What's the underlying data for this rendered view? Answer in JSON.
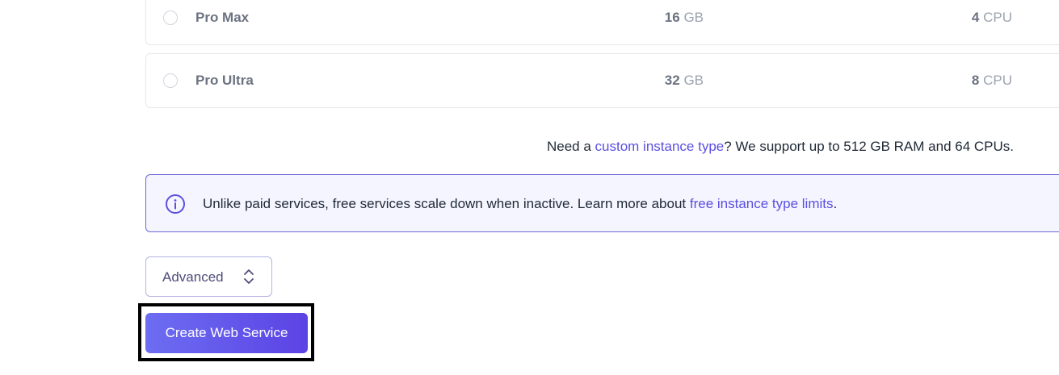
{
  "instance_types": [
    {
      "name": "Pro Max",
      "ram_value": "16",
      "ram_unit": "GB",
      "cpu_value": "4",
      "cpu_unit": "CPU"
    },
    {
      "name": "Pro Ultra",
      "ram_value": "32",
      "ram_unit": "GB",
      "cpu_value": "8",
      "cpu_unit": "CPU"
    }
  ],
  "custom_note": {
    "prefix": "Need a ",
    "link": "custom instance type",
    "suffix": "? We support up to 512 GB RAM and 64 CPUs."
  },
  "info": {
    "text": "Unlike paid services, free services scale down when inactive. Learn more about ",
    "link": "free instance type limits",
    "suffix": ".",
    "icon": "info-circle-icon"
  },
  "advanced": {
    "label": "Advanced",
    "icon": "chevron-up-down-icon"
  },
  "create_button": {
    "label": "Create Web Service"
  },
  "colors": {
    "accent": "#5b4fe0",
    "info_border": "#6b67d6",
    "button_gradient_start": "#6d6df2",
    "button_gradient_end": "#5b43e4"
  }
}
